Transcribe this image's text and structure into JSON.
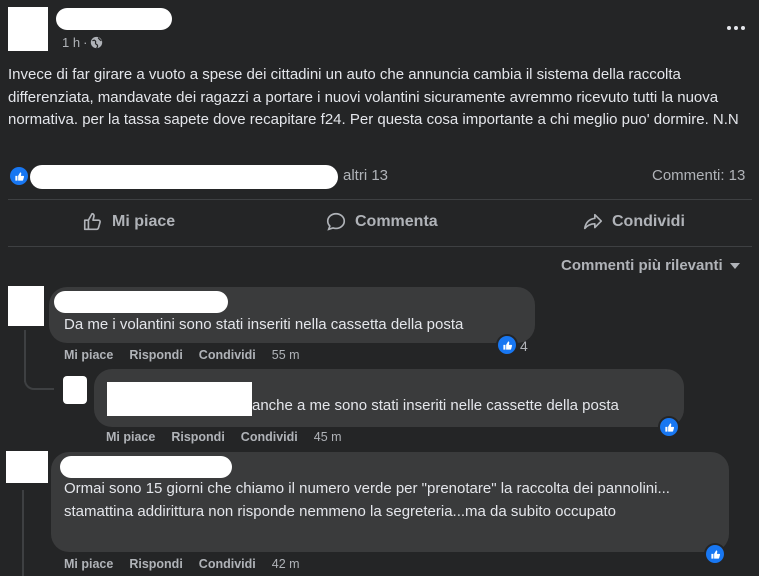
{
  "post": {
    "time": "1 h",
    "text": "Invece di far girare a vuoto a spese dei cittadini un auto che annuncia  cambia il sistema della raccolta differenziata, mandavate dei ragazzi a portare i nuovi volantini sicuramente avremmo ricevuto tutti la nuova  normativa.  per la tassa sapete dove recapitare f24. Per questa cosa importante  a chi meglio puo' dormire.   N.N",
    "reactions_others": "altri 13",
    "comments_count": "Commenti: 13",
    "more_icon": "more-horizontal-icon",
    "privacy_icon": "globe-icon"
  },
  "actions": {
    "like": "Mi piace",
    "comment": "Commenta",
    "share": "Condividi"
  },
  "comments_filter": "Commenti più rilevanti",
  "comment_actions": {
    "like": "Mi piace",
    "reply": "Rispondi",
    "share": "Condividi"
  },
  "comments": [
    {
      "text": "Da me i volantini sono stati inseriti nella cassetta della posta",
      "time": "55 m",
      "reactions": "4"
    },
    {
      "text": "anche a me sono stati inseriti nelle cassette della posta",
      "time": "45 m"
    },
    {
      "text": "Ormai sono 15 giorni che chiamo il numero verde per \"prenotare\" la raccolta dei pannolini... stamattina addirittura non risponde nemmeno la segreteria...ma da subito occupato",
      "time": "42 m"
    }
  ],
  "colors": {
    "background": "#242526",
    "bubble": "#3a3b3c",
    "text": "#e4e6eb",
    "secondary": "#b0b3b8",
    "like_blue": "#1877f2"
  }
}
